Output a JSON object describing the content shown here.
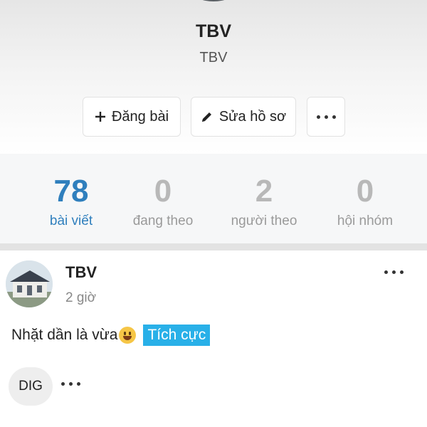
{
  "profile": {
    "name": "TBV",
    "subtitle": "TBV"
  },
  "actions": {
    "post_label": "Đăng bài",
    "edit_label": "Sửa hồ sơ"
  },
  "stats": [
    {
      "value": "78",
      "label": "bài viết",
      "active": true
    },
    {
      "value": "0",
      "label": "đang theo",
      "active": false
    },
    {
      "value": "2",
      "label": "người theo",
      "active": false
    },
    {
      "value": "0",
      "label": "hội nhóm",
      "active": false
    }
  ],
  "post": {
    "author": "TBV",
    "time": "2 giờ",
    "text": "Nhặt dần là vừa",
    "tag": "Tích cực",
    "dig_label": "DIG"
  },
  "colors": {
    "accent": "#2f7fbd",
    "tag_bg": "#29b0e8"
  }
}
